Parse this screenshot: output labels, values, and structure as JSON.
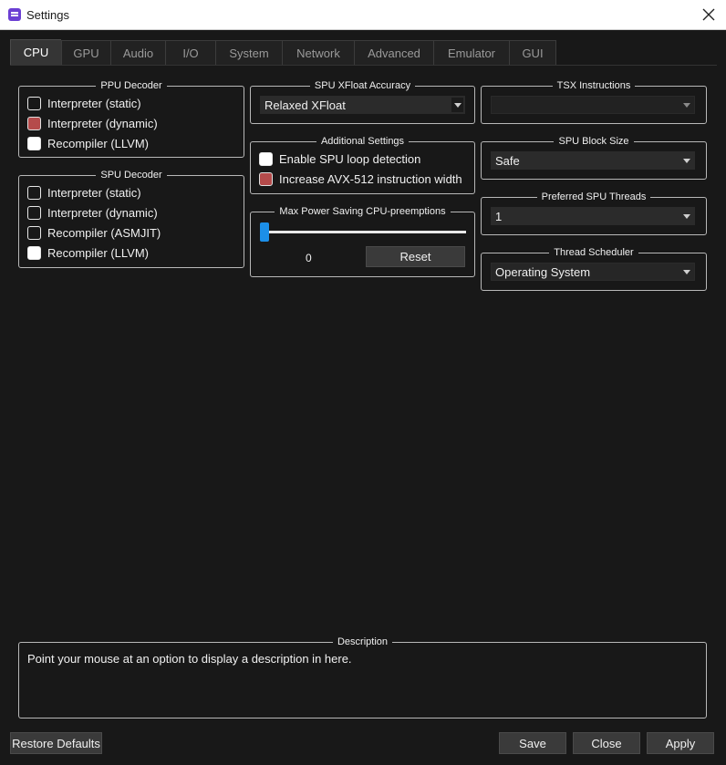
{
  "window": {
    "title": "Settings",
    "close_icon": "close-icon",
    "app_icon": "settings-app-icon"
  },
  "tabs": [
    {
      "label": "CPU",
      "active": true
    },
    {
      "label": "GPU",
      "active": false
    },
    {
      "label": "Audio",
      "active": false
    },
    {
      "label": "I/O",
      "active": false
    },
    {
      "label": "System",
      "active": false
    },
    {
      "label": "Network",
      "active": false
    },
    {
      "label": "Advanced",
      "active": false
    },
    {
      "label": "Emulator",
      "active": false
    },
    {
      "label": "GUI",
      "active": false
    }
  ],
  "ppu_decoder": {
    "title": "PPU Decoder",
    "options": [
      {
        "label": "Interpreter (static)",
        "state": "unchecked"
      },
      {
        "label": "Interpreter (dynamic)",
        "state": "highlighted"
      },
      {
        "label": "Recompiler (LLVM)",
        "state": "selected"
      }
    ]
  },
  "spu_decoder": {
    "title": "SPU Decoder",
    "options": [
      {
        "label": "Interpreter (static)",
        "state": "unchecked"
      },
      {
        "label": "Interpreter (dynamic)",
        "state": "unchecked"
      },
      {
        "label": "Recompiler (ASMJIT)",
        "state": "unchecked"
      },
      {
        "label": "Recompiler (LLVM)",
        "state": "selected"
      }
    ]
  },
  "spu_xfloat": {
    "title": "SPU XFloat Accuracy",
    "value": "Relaxed XFloat"
  },
  "additional": {
    "title": "Additional Settings",
    "options": [
      {
        "label": "Enable SPU loop detection",
        "state": "selected"
      },
      {
        "label": "Increase AVX-512 instruction width",
        "state": "highlighted"
      }
    ]
  },
  "max_power": {
    "title": "Max Power Saving CPU-preemptions",
    "value": "0",
    "fraction": 0,
    "reset_label": "Reset"
  },
  "tsx": {
    "title": "TSX Instructions",
    "value": ""
  },
  "spu_block": {
    "title": "SPU Block Size",
    "value": "Safe"
  },
  "spu_threads": {
    "title": "Preferred SPU Threads",
    "value": "1"
  },
  "scheduler": {
    "title": "Thread Scheduler",
    "value": "Operating System"
  },
  "description": {
    "title": "Description",
    "text": "Point your mouse at an option to display a description in here."
  },
  "buttons": {
    "restore": "Restore Defaults",
    "save": "Save",
    "close": "Close",
    "apply": "Apply"
  },
  "colors": {
    "accent": "#1c8fe8",
    "checked_red": "#b54b4b",
    "background": "#181818"
  }
}
